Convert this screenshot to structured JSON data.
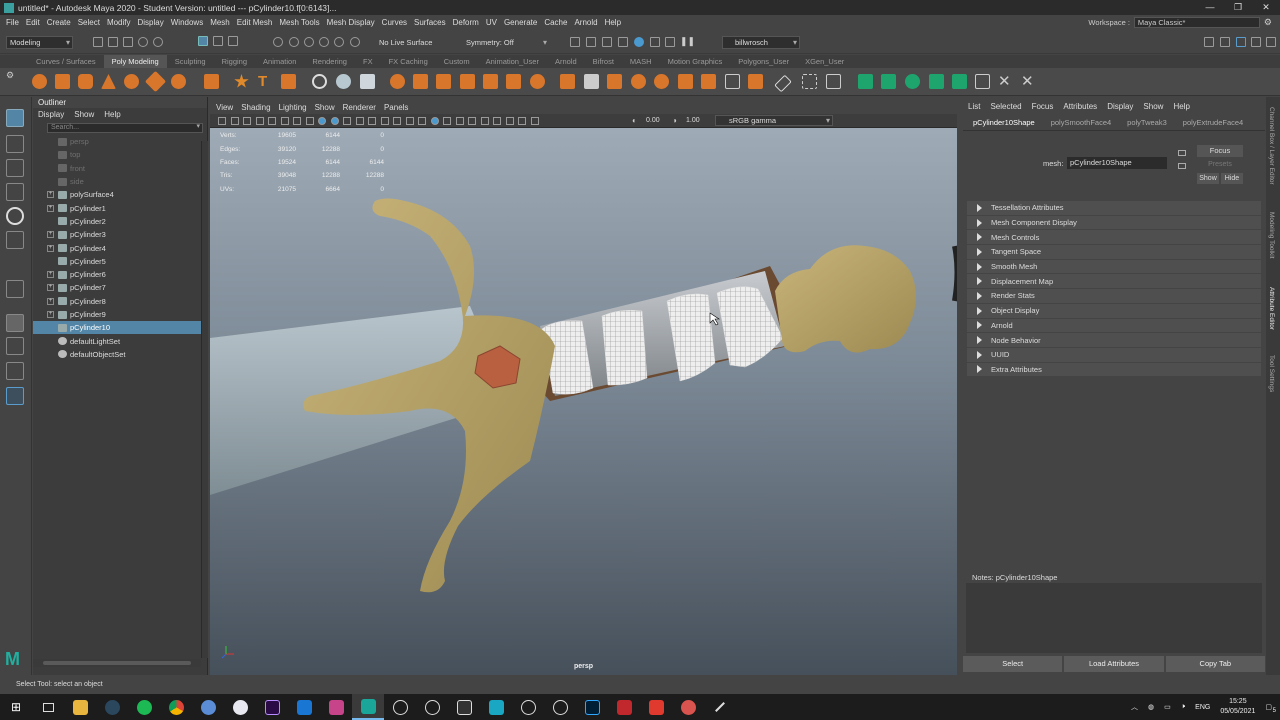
{
  "title": {
    "text": "untitled* - Autodesk Maya 2020 - Student Version: untitled   ---   pCylinder10.f[0:6143]..."
  },
  "menubar": {
    "items": [
      "File",
      "Edit",
      "Create",
      "Select",
      "Modify",
      "Display",
      "Windows",
      "Mesh",
      "Edit Mesh",
      "Mesh Tools",
      "Mesh Display",
      "Curves",
      "Surfaces",
      "Deform",
      "UV",
      "Generate",
      "Cache",
      "Arnold",
      "Help"
    ],
    "workspace_label": "Workspace :",
    "workspace_value": "Maya Classic*"
  },
  "statusline": {
    "mode": "Modeling",
    "live_surface": "No Live Surface",
    "symmetry": "Symmetry: Off",
    "user": "billwrosch"
  },
  "shelf_tabs": [
    "Curves / Surfaces",
    "Poly Modeling",
    "Sculpting",
    "Rigging",
    "Animation",
    "Rendering",
    "FX",
    "FX Caching",
    "Custom",
    "Animation_User",
    "Arnold",
    "Bifrost",
    "MASH",
    "Motion Graphics",
    "Polygons_User",
    "XGen_User"
  ],
  "active_shelf": "Poly Modeling",
  "outliner": {
    "title": "Outliner",
    "menu": [
      "Display",
      "Show",
      "Help"
    ],
    "search_placeholder": "Search...",
    "items": [
      {
        "label": "persp",
        "kind": "camera",
        "expand": false,
        "dim": true
      },
      {
        "label": "top",
        "kind": "camera",
        "expand": false,
        "dim": true
      },
      {
        "label": "front",
        "kind": "camera",
        "expand": false,
        "dim": true
      },
      {
        "label": "side",
        "kind": "camera",
        "expand": false,
        "dim": true
      },
      {
        "label": "polySurface4",
        "kind": "mesh",
        "expand": true
      },
      {
        "label": "pCylinder1",
        "kind": "mesh",
        "expand": true
      },
      {
        "label": "pCylinder2",
        "kind": "mesh",
        "expand": false
      },
      {
        "label": "pCylinder3",
        "kind": "mesh",
        "expand": true
      },
      {
        "label": "pCylinder4",
        "kind": "mesh",
        "expand": true
      },
      {
        "label": "pCylinder5",
        "kind": "mesh",
        "expand": false
      },
      {
        "label": "pCylinder6",
        "kind": "mesh",
        "expand": true
      },
      {
        "label": "pCylinder7",
        "kind": "mesh",
        "expand": true
      },
      {
        "label": "pCylinder8",
        "kind": "mesh",
        "expand": true
      },
      {
        "label": "pCylinder9",
        "kind": "mesh",
        "expand": true
      },
      {
        "label": "pCylinder10",
        "kind": "mesh",
        "expand": false,
        "selected": true
      },
      {
        "label": "defaultLightSet",
        "kind": "set",
        "expand": false
      },
      {
        "label": "defaultObjectSet",
        "kind": "set",
        "expand": false
      }
    ]
  },
  "viewport": {
    "menu": [
      "View",
      "Shading",
      "Lighting",
      "Show",
      "Renderer",
      "Panels"
    ],
    "exposure": "0.00",
    "gamma": "1.00",
    "color_space": "sRGB gamma",
    "camera": "persp",
    "hud": [
      {
        "label": "Verts:",
        "a": "19605",
        "b": "6144",
        "c": "0"
      },
      {
        "label": "Edges:",
        "a": "39120",
        "b": "12288",
        "c": "0"
      },
      {
        "label": "Faces:",
        "a": "19524",
        "b": "6144",
        "c": "6144"
      },
      {
        "label": "Tris:",
        "a": "39048",
        "b": "12288",
        "c": "12288"
      },
      {
        "label": "UVs:",
        "a": "21075",
        "b": "6664",
        "c": "0"
      }
    ]
  },
  "attribute_editor": {
    "menu": [
      "List",
      "Selected",
      "Focus",
      "Attributes",
      "Display",
      "Show",
      "Help"
    ],
    "tabs": [
      "pCylinder10Shape",
      "polySmoothFace4",
      "polyTweak3",
      "polyExtrudeFace4"
    ],
    "mesh_label": "mesh:",
    "mesh_value": "pCylinder10Shape",
    "focus_btn": "Focus",
    "presets_btn": "Presets",
    "show_btn": "Show",
    "hide_btn": "Hide",
    "sections": [
      "Tessellation Attributes",
      "Mesh Component Display",
      "Mesh Controls",
      "Tangent Space",
      "Smooth Mesh",
      "Displacement Map",
      "Render Stats",
      "Object Display",
      "Arnold",
      "Node Behavior",
      "UUID",
      "Extra Attributes"
    ],
    "notes_label": "Notes:  pCylinder10Shape",
    "buttons": [
      "Select",
      "Load Attributes",
      "Copy Tab"
    ]
  },
  "side_tabs": [
    "Channel Box / Layer Editor",
    "Modeling Toolkit",
    "Attribute Editor",
    "Tool Settings"
  ],
  "help_line": "Select Tool: select an object",
  "taskbar": {
    "lang": "ENG",
    "time": "15:25",
    "date": "05/05/2021",
    "notif": "5"
  },
  "colors": {
    "accent": "#5285a6",
    "guard": "#b8a46a",
    "grip": "#9a9ea3",
    "gem": "#b8603f",
    "wire": "#f2f2f2"
  }
}
